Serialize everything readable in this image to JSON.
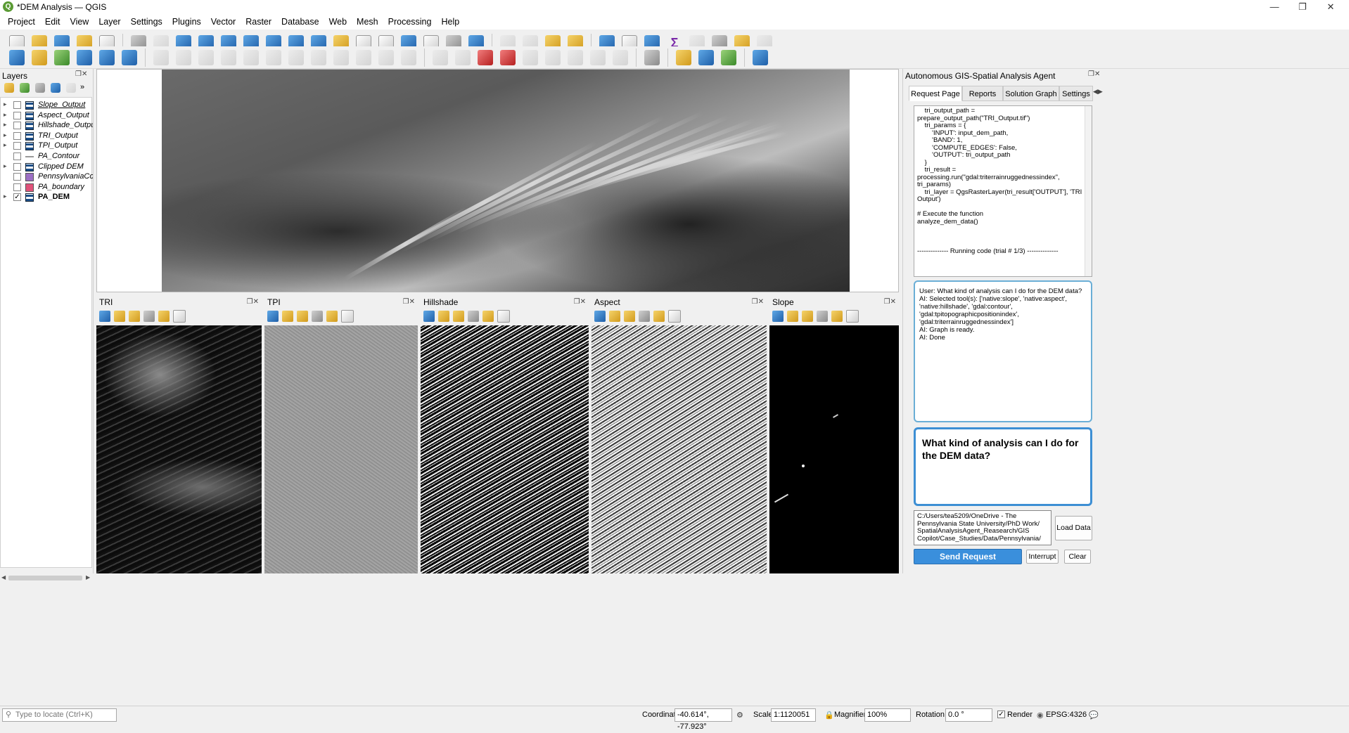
{
  "window": {
    "title": "*DEM Analysis — QGIS",
    "app_icon": "Q"
  },
  "menu": [
    "Project",
    "Edit",
    "View",
    "Layer",
    "Settings",
    "Plugins",
    "Vector",
    "Raster",
    "Database",
    "Web",
    "Mesh",
    "Processing",
    "Help"
  ],
  "layers_panel": {
    "title": "Layers",
    "layers": [
      {
        "name": "Slope_Output",
        "checked": false,
        "expandable": true,
        "type": "raster"
      },
      {
        "name": "Aspect_Output",
        "checked": false,
        "expandable": true,
        "type": "raster"
      },
      {
        "name": "Hillshade_Output",
        "checked": false,
        "expandable": true,
        "type": "raster"
      },
      {
        "name": "TRI_Output",
        "checked": false,
        "expandable": true,
        "type": "raster"
      },
      {
        "name": "TPI_Output",
        "checked": false,
        "expandable": true,
        "type": "raster"
      },
      {
        "name": "PA_Contour",
        "checked": false,
        "expandable": false,
        "type": "line"
      },
      {
        "name": "Clipped DEM",
        "checked": false,
        "expandable": true,
        "type": "raster"
      },
      {
        "name": "PennsylvaniaCounties",
        "checked": false,
        "expandable": false,
        "type": "polygon",
        "color": "#9c6fc4"
      },
      {
        "name": "PA_boundary",
        "checked": false,
        "expandable": false,
        "type": "polygon",
        "color": "#e0527a"
      },
      {
        "name": "PA_DEM",
        "checked": true,
        "expandable": true,
        "type": "raster"
      }
    ]
  },
  "map_views": [
    {
      "title": "TRI"
    },
    {
      "title": "TPI"
    },
    {
      "title": "Hillshade"
    },
    {
      "title": "Aspect"
    },
    {
      "title": "Slope"
    }
  ],
  "agent_panel": {
    "title": "Autonomous GIS-Spatial Analysis Agent",
    "tabs": [
      "Request Page",
      "Reports",
      "Solution Graph",
      "Settings"
    ],
    "active_tab": "Request Page",
    "code_output": "    tri_output_path =\nprepare_output_path(\"TRI_Output.tif\")\n    tri_params = {\n        'INPUT': input_dem_path,\n        'BAND': 1,\n        'COMPUTE_EDGES': False,\n        'OUTPUT': tri_output_path\n    }\n    tri_result =\nprocessing.run(\"gdal:triterrainruggednessindex\",\ntri_params)\n    tri_layer = QgsRasterLayer(tri_result['OUTPUT'], 'TRI\nOutput')\n\n# Execute the function\nanalyze_dem_data()\n\n\n\n-------------- Running code (trial # 1/3) --------------",
    "chat_log": "User: What kind of analysis can I do for the DEM data?\nAI: Selected tool(s): ['native:slope', 'native:aspect',\n'native:hillshade', 'gdal:contour',\n'gdal:tpitopographicpositionindex',\n'gdal:triterrainruggednessindex']\nAI: Graph is ready.\nAI: Done",
    "request_input": "What kind of analysis can I do for the DEM data?",
    "data_path": "C:/Users/tea5209/OneDrive - The Pennsylvania State University/PhD Work/ SpatialAnalysisAgent_Reasearch/GIS Copilot/Case_Studies/Data/Pennsylvania/",
    "load_data_label": "Load Data",
    "send_label": "Send Request",
    "interrupt_label": "Interrupt",
    "clear_label": "Clear"
  },
  "status_bar": {
    "locate_placeholder": "Type to locate (Ctrl+K)",
    "coordinate_label": "Coordinate",
    "coordinate_value": "-40.614°, -77.923°",
    "scale_label": "Scale",
    "scale_value": "1:1120051",
    "magnifier_label": "Magnifier",
    "magnifier_value": "100%",
    "rotation_label": "Rotation",
    "rotation_value": "0.0 °",
    "render_label": "Render",
    "crs": "EPSG:4326"
  },
  "colors": {
    "accent": "#3a8fdc",
    "chat_border": "#6aaed6",
    "input_border": "#3d8fd4",
    "qgis_green": "#5b9b35"
  }
}
